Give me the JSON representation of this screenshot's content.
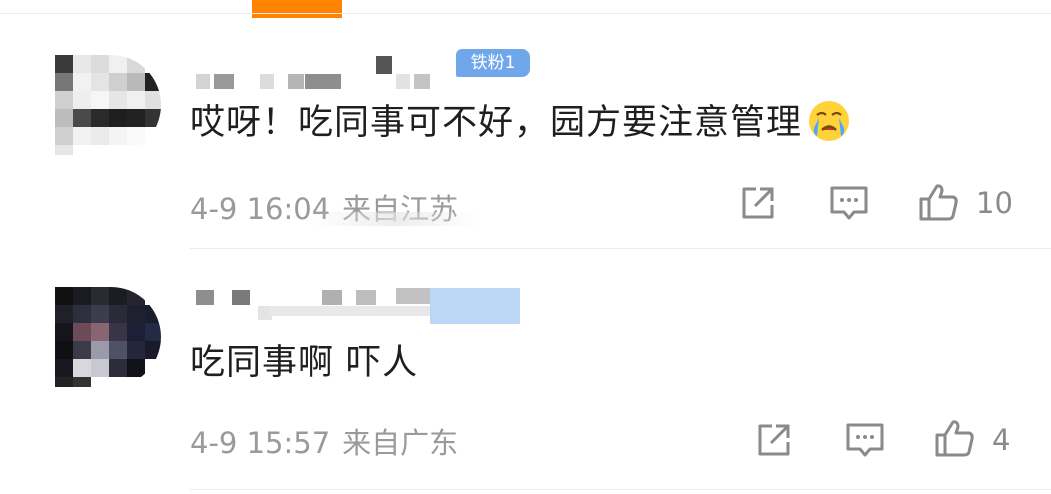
{
  "comments": [
    {
      "badge": "铁粉1",
      "text": "哎呀！吃同事可不好，园方要注意管理",
      "emoji": "crying-face",
      "date": "4-9 16:04",
      "location": "来自江苏",
      "likes": "10"
    },
    {
      "text": "吃同事啊  吓人",
      "date": "4-9 15:57",
      "location": "来自广东",
      "likes": "4"
    }
  ],
  "colors": {
    "accent": "#ff8200",
    "badge": "#6fa7ea",
    "meta_text": "#9a9a9a",
    "divider": "#ececec"
  },
  "icons": [
    "share-icon",
    "comment-icon",
    "like-icon"
  ]
}
